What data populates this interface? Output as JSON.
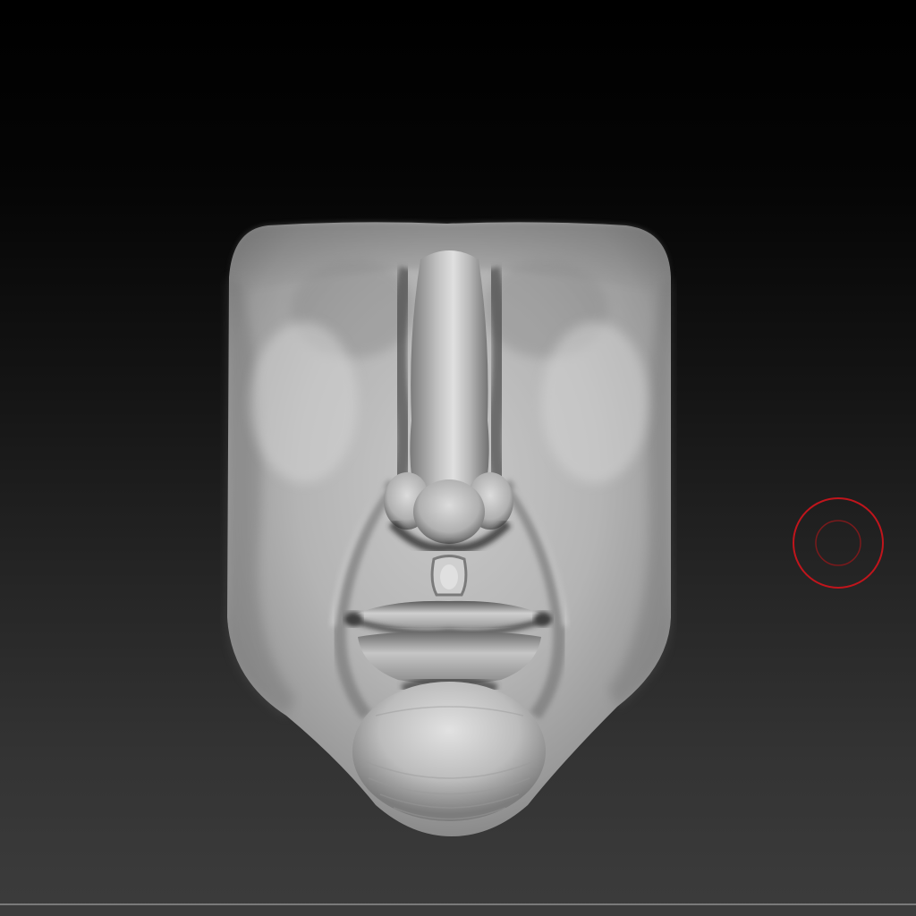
{
  "viewport": {
    "background_top": "#000000",
    "background_bottom": "#3c3c3c"
  },
  "model": {
    "kind": "sculpted-face-mesh",
    "material_color": "#bdbdbd"
  },
  "brush_cursor": {
    "color": "#c0151c"
  }
}
